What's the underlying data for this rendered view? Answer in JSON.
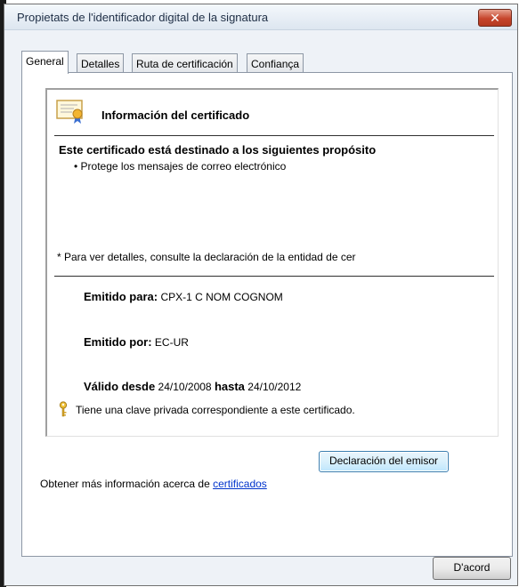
{
  "window": {
    "title": "Propietats de l'identificador digital de la signatura",
    "close_label": "✕"
  },
  "tabs": [
    {
      "label": "General",
      "active": true
    },
    {
      "label": "Detalles",
      "active": false
    },
    {
      "label": "Ruta de certificación",
      "active": false
    },
    {
      "label": "Confiança",
      "active": false
    }
  ],
  "certificate": {
    "header": "Información del certificado",
    "purpose_heading": "Este certificado está destinado a los siguientes propósito",
    "purposes": [
      "• Protege los mensajes de correo electrónico"
    ],
    "footnote": "* Para ver detalles, consulte la declaración de la entidad de cer",
    "issued_to_label": "Emitido para",
    "issued_to_value": "CPX-1 C NOM COGNOM",
    "issued_by_label": "Emitido por",
    "issued_by_value": "EC-UR",
    "valid_from_label": "Válido desde",
    "valid_from_value": "24/10/2008",
    "valid_to_label": "hasta",
    "valid_to_value": "24/10/2012",
    "private_key_note": "Tiene una clave privada correspondiente a este certificado."
  },
  "buttons": {
    "issuer_statement": "Declaración del emisor",
    "ok": "D'acord"
  },
  "more_info": {
    "text": "Obtener más información acerca de ",
    "link": "certificados"
  },
  "colors": {
    "window_bg": "#eef2f7",
    "link": "#0033cc",
    "close_button": "#c6452c"
  }
}
